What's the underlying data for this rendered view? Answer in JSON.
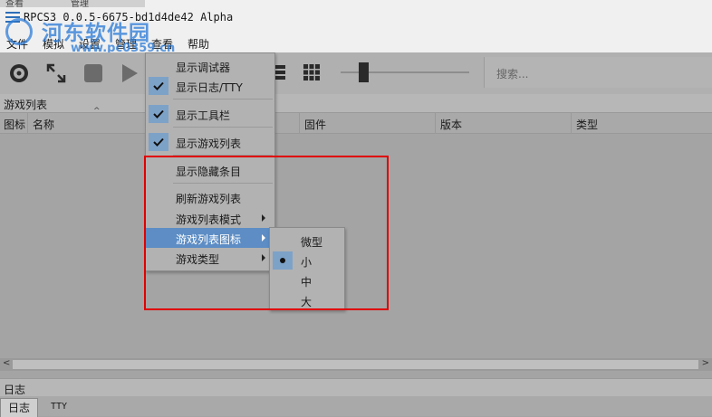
{
  "window": {
    "title": "RPCS3 0.0.5-6675-bd1d4de42 Alpha",
    "top_strip": [
      "查看",
      "管理"
    ]
  },
  "watermark": {
    "text": "河东软件园",
    "url": "www.pc0359.cn"
  },
  "menubar": [
    "文件",
    "模拟",
    "设置",
    "管理",
    "查看",
    "帮助"
  ],
  "toolbar": {
    "icons": [
      "disc-icon",
      "fullscreen-icon",
      "stop-icon",
      "play-icon",
      "list-view-icon",
      "grid-view-icon"
    ],
    "search_placeholder": "搜索..."
  },
  "game_list": {
    "title": "游戏列表",
    "columns": [
      "图标",
      "名称",
      "固件",
      "版本",
      "类型"
    ]
  },
  "log": {
    "title": "日志",
    "tabs": [
      "日志",
      "TTY"
    ]
  },
  "view_menu": {
    "items": [
      {
        "label": "显示调试器",
        "checked": false
      },
      {
        "label": "显示日志/TTY",
        "checked": true
      },
      {
        "label": "显示工具栏",
        "checked": true
      },
      {
        "label": "显示游戏列表",
        "checked": true
      },
      {
        "label": "显示隐藏条目",
        "checked": false
      },
      {
        "label": "刷新游戏列表",
        "checked": false
      },
      {
        "label": "游戏列表模式",
        "submenu": true
      },
      {
        "label": "游戏列表图标",
        "submenu": true,
        "highlighted": true
      },
      {
        "label": "游戏类型",
        "submenu": true
      }
    ]
  },
  "icon_size_menu": {
    "items": [
      "微型",
      "小",
      "中",
      "大"
    ],
    "selected": "小"
  },
  "colors": {
    "highlight": "#5d8dc4",
    "annotation_box": "#e00000",
    "check_bg": "#7da2c8"
  }
}
